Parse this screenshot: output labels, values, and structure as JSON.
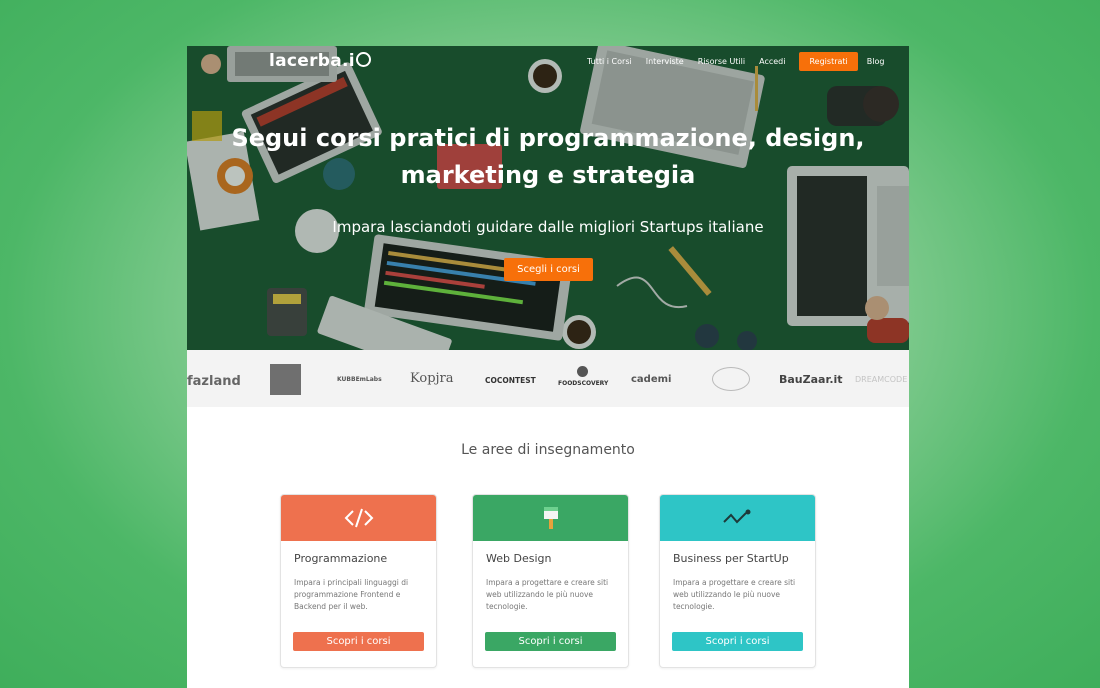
{
  "brand": {
    "logo_text": "lacerba.i"
  },
  "nav": {
    "items": [
      "Tutti i Corsi",
      "Interviste",
      "Risorse Utili",
      "Accedi"
    ],
    "register_label": "Registrati",
    "blog_label": "Blog"
  },
  "hero": {
    "title_line1": "Segui corsi pratici di programmazione, design,",
    "title_line2": "marketing e strategia",
    "subtitle": "Impara lasciandoti guidare dalle migliori Startups italiane",
    "cta_label": "Scegli i corsi"
  },
  "partners": [
    "fazland",
    "KUBBEmLabs",
    "Kopjra",
    "COCONTEST",
    "FOODSCOVERY",
    "cademi",
    "BauZaar.it",
    "DREAMCODE"
  ],
  "section": {
    "title": "Le  aree di insegnamento"
  },
  "cards": [
    {
      "title": "Programmazione",
      "desc": "Impara i principali linguaggi di programmazione Frontend e Backend per il web.",
      "button": "Scopri i corsi",
      "icon": "code-icon",
      "color": "#ee714e"
    },
    {
      "title": "Web Design",
      "desc": "Impara a progettare e creare siti web utilizzando le più nuove tecnologie.",
      "button": "Scopri i corsi",
      "icon": "paintbrush-icon",
      "color": "#3aa764"
    },
    {
      "title": "Business per StartUp",
      "desc": "Impara a progettare e creare siti web utilizzando le più nuove tecnologie.",
      "button": "Scopri i corsi",
      "icon": "chart-line-icon",
      "color": "#2ec5c6"
    }
  ],
  "colors": {
    "accent": "#f7700a",
    "hero_bg": "#1f5a36",
    "page_bg": "#4db767"
  }
}
